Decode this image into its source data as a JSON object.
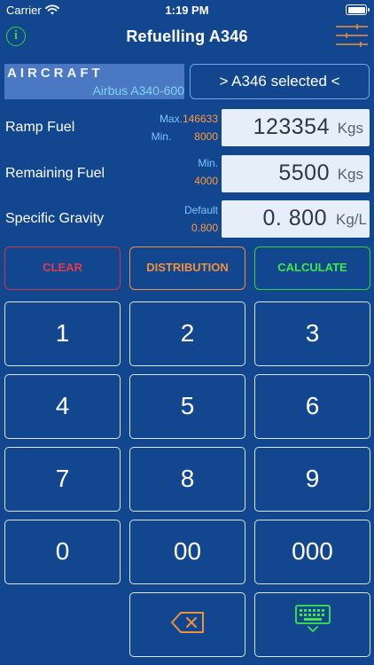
{
  "status_bar": {
    "carrier": "Carrier",
    "time": "1:19 PM"
  },
  "nav": {
    "title": "Refuelling A346",
    "info_icon": "info-circle-icon",
    "settings_icon": "sliders-icon"
  },
  "aircraft": {
    "label": "AIRCRAFT",
    "model": "Airbus A340-600",
    "select_button": "> A346 selected <"
  },
  "ramp_fuel": {
    "label": "Ramp Fuel",
    "max_label": "Max.",
    "max_value": "146633",
    "min_label": "Min.",
    "min_value": "8000",
    "value": "123354",
    "unit": "Kgs"
  },
  "remaining_fuel": {
    "label": "Remaining Fuel",
    "min_label": "Min.",
    "min_value": "4000",
    "value": "5500",
    "unit": "Kgs"
  },
  "specific_gravity": {
    "label": "Specific Gravity",
    "default_label": "Default",
    "default_value": "0.800",
    "value": "0. 800",
    "unit": "Kg/L"
  },
  "actions": {
    "clear": "CLEAR",
    "distribution": "DISTRIBUTION",
    "calculate": "CALCULATE"
  },
  "keypad": {
    "k1": "1",
    "k2": "2",
    "k3": "3",
    "k4": "4",
    "k5": "5",
    "k6": "6",
    "k7": "7",
    "k8": "8",
    "k9": "9",
    "k0": "0",
    "k00": "00",
    "k000": "000",
    "backspace_icon": "backspace-icon",
    "keyboard_icon": "keyboard-dismiss-icon"
  },
  "colors": {
    "background": "#12468f",
    "clear": "#e23b4c",
    "distribution": "#f0913b",
    "calculate": "#3ee84a",
    "accent_green": "#38d13b"
  }
}
